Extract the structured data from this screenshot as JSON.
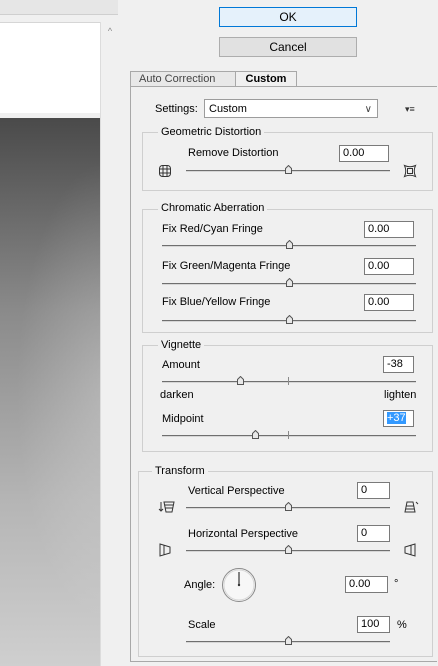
{
  "buttons": {
    "ok": "OK",
    "cancel": "Cancel"
  },
  "tabs": [
    {
      "label": "Auto Correction"
    },
    {
      "label": "Custom"
    }
  ],
  "settings": {
    "label": "Settings:",
    "value": "Custom"
  },
  "geometric_distortion": {
    "title": "Geometric Distortion",
    "remove_distortion": {
      "label": "Remove Distortion",
      "value": "0.00",
      "slider_fraction": 0.5
    }
  },
  "chromatic_aberration": {
    "title": "Chromatic Aberration",
    "red_cyan": {
      "label": "Fix Red/Cyan Fringe",
      "value": "0.00",
      "slider_fraction": 0.5
    },
    "green_magenta": {
      "label": "Fix Green/Magenta Fringe",
      "value": "0.00",
      "slider_fraction": 0.5
    },
    "blue_yellow": {
      "label": "Fix Blue/Yellow Fringe",
      "value": "0.00",
      "slider_fraction": 0.5
    }
  },
  "vignette": {
    "title": "Vignette",
    "amount": {
      "label": "Amount",
      "value": "-38",
      "slider_fraction": 0.31
    },
    "darken": "darken",
    "lighten": "lighten",
    "midpoint": {
      "label": "Midpoint",
      "value": "+37",
      "slider_fraction": 0.37
    }
  },
  "transform": {
    "title": "Transform",
    "vertical_perspective": {
      "label": "Vertical Perspective",
      "value": "0",
      "slider_fraction": 0.5
    },
    "horizontal_perspective": {
      "label": "Horizontal Perspective",
      "value": "0",
      "slider_fraction": 0.5
    },
    "angle": {
      "label": "Angle:",
      "value": "0.00",
      "unit": "°"
    },
    "scale": {
      "label": "Scale",
      "value": "100",
      "unit": "%",
      "slider_fraction": 0.5
    }
  }
}
